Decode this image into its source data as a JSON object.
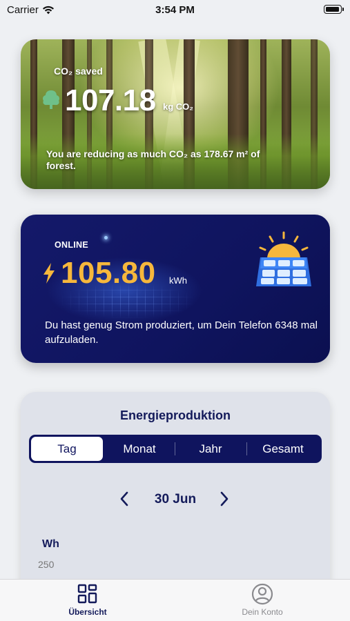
{
  "status_bar": {
    "carrier": "Carrier",
    "time": "3:54 PM"
  },
  "co2_card": {
    "label": "CO₂ saved",
    "value": "107.18",
    "unit": "kg CO₂",
    "description": "You are reducing as much CO₂ as 178.67 m² of forest."
  },
  "energy_card": {
    "status": "ONLINE",
    "value": "105.80",
    "unit": "kWh",
    "description": "Du hast genug Strom produziert, um Dein Telefon 6348 mal aufzuladen.",
    "accent_color": "#f6b73c"
  },
  "production": {
    "title": "Energieproduktion",
    "tabs": [
      {
        "label": "Tag",
        "selected": true
      },
      {
        "label": "Monat",
        "selected": false
      },
      {
        "label": "Jahr",
        "selected": false
      },
      {
        "label": "Gesamt",
        "selected": false
      }
    ],
    "date": "30 Jun",
    "unit": "Wh",
    "y_tick_top": "250"
  },
  "tab_bar": {
    "items": [
      {
        "label": "Übersicht",
        "icon": "grid-icon",
        "active": true
      },
      {
        "label": "Dein Konto",
        "icon": "person-icon",
        "active": false
      }
    ]
  },
  "colors": {
    "navy": "#0f145e",
    "background": "#eef0f3"
  }
}
